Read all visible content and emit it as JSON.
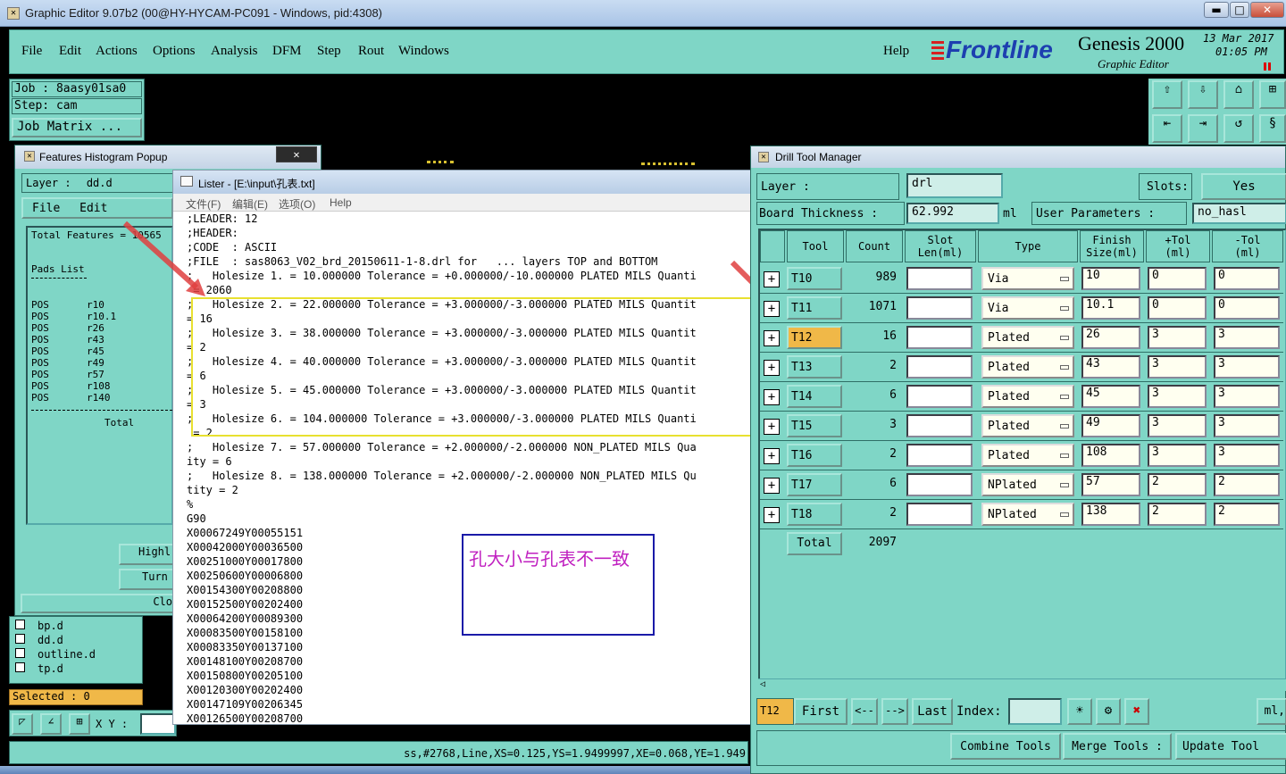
{
  "window": {
    "title": "Graphic Editor 9.07b2 (00@HY-HYCAM-PC091 - Windows, pid:4308)",
    "btn_min": "▬",
    "btn_max": "□",
    "btn_close": "✕"
  },
  "menubar": {
    "items": [
      "File",
      "Edit",
      "Actions",
      "Options",
      "Analysis",
      "DFM",
      "Step",
      "Rout",
      "Windows"
    ],
    "help": "Help",
    "brand": "Frontline",
    "product": "Genesis 2000",
    "subtitle": "Graphic Editor",
    "date": "13 Mar 2017",
    "time": "01:05 PM"
  },
  "job": {
    "job": "Job : 8aasy01sa0",
    "step": "Step: cam",
    "matrix": "Job Matrix ..."
  },
  "histogram": {
    "title": "Features Histogram Popup",
    "close": "✕",
    "layer_label": "Layer :",
    "layer_value": "dd.d",
    "menu": [
      "File",
      "Edit"
    ],
    "total_label": "Total Features = 10565",
    "pads_title": "Pads List",
    "rows": [
      {
        "pos": "POS",
        "name": "r10"
      },
      {
        "pos": "POS",
        "name": "r10.1"
      },
      {
        "pos": "POS",
        "name": "r26"
      },
      {
        "pos": "POS",
        "name": "r43"
      },
      {
        "pos": "POS",
        "name": "r45"
      },
      {
        "pos": "POS",
        "name": "r49"
      },
      {
        "pos": "POS",
        "name": "r57"
      },
      {
        "pos": "POS",
        "name": "r108"
      },
      {
        "pos": "POS",
        "name": "r140"
      }
    ],
    "total": "Total",
    "btn_highlight": "Highl",
    "btn_turn": "Turn",
    "btn_close": "Clo"
  },
  "layers_list": [
    "bp.d",
    "dd.d",
    "outline.d",
    "tp.d"
  ],
  "status": {
    "selected": "Selected : 0",
    "xy": "X Y :",
    "coords": "ss,#2768,Line,XS=0.125,YS=1.9499997,XE=0.068,YE=1.949"
  },
  "lister": {
    "title": "Lister - [E:\\input\\孔表.txt]",
    "menu": [
      "文件(F)",
      "编辑(E)",
      "选项(O)",
      "Help"
    ],
    "lines": [
      ";LEADER: 12",
      ";HEADER:",
      ";CODE  : ASCII",
      ";FILE  : sas8063_V02_brd_20150611-1-8.drl for   ... layers TOP and BOTTOM",
      ";   Holesize 1. = 10.000000 Tolerance = +0.000000/-10.000000 PLATED MILS Quanti",
      " = 2060",
      ";   Holesize 2. = 22.000000 Tolerance = +3.000000/-3.000000 PLATED MILS Quantit",
      "= 16",
      ";   Holesize 3. = 38.000000 Tolerance = +3.000000/-3.000000 PLATED MILS Quantit",
      "= 2",
      ";   Holesize 4. = 40.000000 Tolerance = +3.000000/-3.000000 PLATED MILS Quantit",
      "= 6",
      ";   Holesize 5. = 45.000000 Tolerance = +3.000000/-3.000000 PLATED MILS Quantit",
      "= 3",
      ";   Holesize 6. = 104.000000 Tolerance = +3.000000/-3.000000 PLATED MILS Quanti",
      " = 2",
      ";   Holesize 7. = 57.000000 Tolerance = +2.000000/-2.000000 NON_PLATED MILS Qua",
      "ity = 6",
      ";   Holesize 8. = 138.000000 Tolerance = +2.000000/-2.000000 NON_PLATED MILS Qu",
      "tity = 2",
      "%",
      "G90",
      "X00067249Y00055151",
      "X00042000Y00036500",
      "X00251000Y00017800",
      "X00250600Y00006800",
      "X00154300Y00208800",
      "X00152500Y00202400",
      "X00064200Y00089300",
      "X00083500Y00158100",
      "X00083350Y00137100",
      "X00148100Y00208700",
      "X00150800Y00205100",
      "X00120300Y00202400",
      "X00147109Y00206345",
      "X00126500Y00208700"
    ],
    "annotation": "孔大小与孔表不一致"
  },
  "drill": {
    "title": "Drill Tool Manager",
    "layer_label": "Layer          :",
    "layer_value": "drl",
    "slots_label": "Slots:",
    "slots_value": "Yes",
    "thickness_label": "Board Thickness :",
    "thickness_value": "62.992",
    "thickness_unit": "ml",
    "userparams_label": "User Parameters :",
    "userparams_value": "no_hasl",
    "headers": [
      "Tool",
      "Count",
      "Slot\nLen(ml)",
      "Type",
      "Finish\nSize(ml)",
      "+Tol\n(ml)",
      "-Tol\n(ml)"
    ],
    "rows": [
      {
        "tool": "T10",
        "count": "989",
        "type": "Via",
        "finish": "10",
        "ptol": "0",
        "mtol": "0"
      },
      {
        "tool": "T11",
        "count": "1071",
        "type": "Via",
        "finish": "10.1",
        "ptol": "0",
        "mtol": "0"
      },
      {
        "tool": "T12",
        "count": "16",
        "type": "Plated",
        "finish": "26",
        "ptol": "3",
        "mtol": "3"
      },
      {
        "tool": "T13",
        "count": "2",
        "type": "Plated",
        "finish": "43",
        "ptol": "3",
        "mtol": "3"
      },
      {
        "tool": "T14",
        "count": "6",
        "type": "Plated",
        "finish": "45",
        "ptol": "3",
        "mtol": "3"
      },
      {
        "tool": "T15",
        "count": "3",
        "type": "Plated",
        "finish": "49",
        "ptol": "3",
        "mtol": "3"
      },
      {
        "tool": "T16",
        "count": "2",
        "type": "Plated",
        "finish": "108",
        "ptol": "3",
        "mtol": "3"
      },
      {
        "tool": "T17",
        "count": "6",
        "type": "NPlated",
        "finish": "57",
        "ptol": "2",
        "mtol": "2"
      },
      {
        "tool": "T18",
        "count": "2",
        "type": "NPlated",
        "finish": "138",
        "ptol": "2",
        "mtol": "2"
      }
    ],
    "total_label": "Total",
    "total_value": "2097",
    "current": "T12",
    "nav": [
      "First",
      "<--",
      "-->",
      "Last"
    ],
    "index_label": "Index:",
    "unit_right": "ml,",
    "btn_combine": "Combine Tools",
    "btn_merge": "Merge Tools  :",
    "btn_update": "Update Tool"
  }
}
